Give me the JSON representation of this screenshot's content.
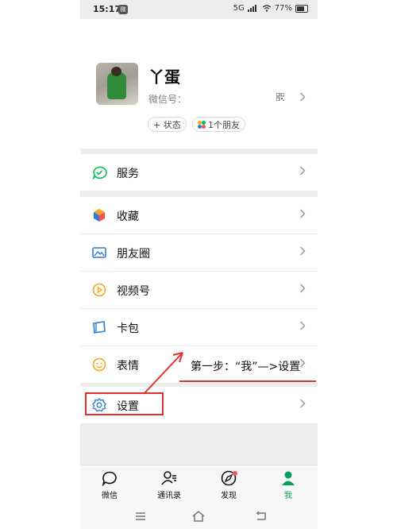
{
  "status_bar": {
    "time": "15:17",
    "notification_badge": "微",
    "network": "5G",
    "battery": "77%"
  },
  "profile": {
    "name": "丫蛋",
    "wechat_id_label": "微信号：",
    "status_button": "+ 状态",
    "friends_button": "1个朋友"
  },
  "menu": {
    "items": [
      {
        "label": "服务",
        "icon": "service-check-icon",
        "color": "#07c160"
      },
      {
        "label": "收藏",
        "icon": "favorites-cube-icon",
        "color": "#f5a623"
      },
      {
        "label": "朋友圈",
        "icon": "moments-image-icon",
        "color": "#2e7dd7"
      },
      {
        "label": "视频号",
        "icon": "channels-play-icon",
        "color": "#f5a623"
      },
      {
        "label": "卡包",
        "icon": "card-wallet-icon",
        "color": "#2e7dd7"
      },
      {
        "label": "表情",
        "icon": "sticker-smile-icon",
        "color": "#f5a623"
      },
      {
        "label": "设置",
        "icon": "settings-gear-icon",
        "color": "#2e7dd7"
      }
    ]
  },
  "tabs": [
    {
      "label": "微信",
      "icon": "chat-bubble-icon",
      "active": false
    },
    {
      "label": "通讯录",
      "icon": "contacts-icon",
      "active": false
    },
    {
      "label": "发现",
      "icon": "discover-compass-icon",
      "active": false,
      "badge": true
    },
    {
      "label": "我",
      "icon": "me-person-icon",
      "active": true
    }
  ],
  "annotation": {
    "text": "第一步：“我”—>设置",
    "color": "#e03030"
  },
  "accent_color": "#07a15a"
}
